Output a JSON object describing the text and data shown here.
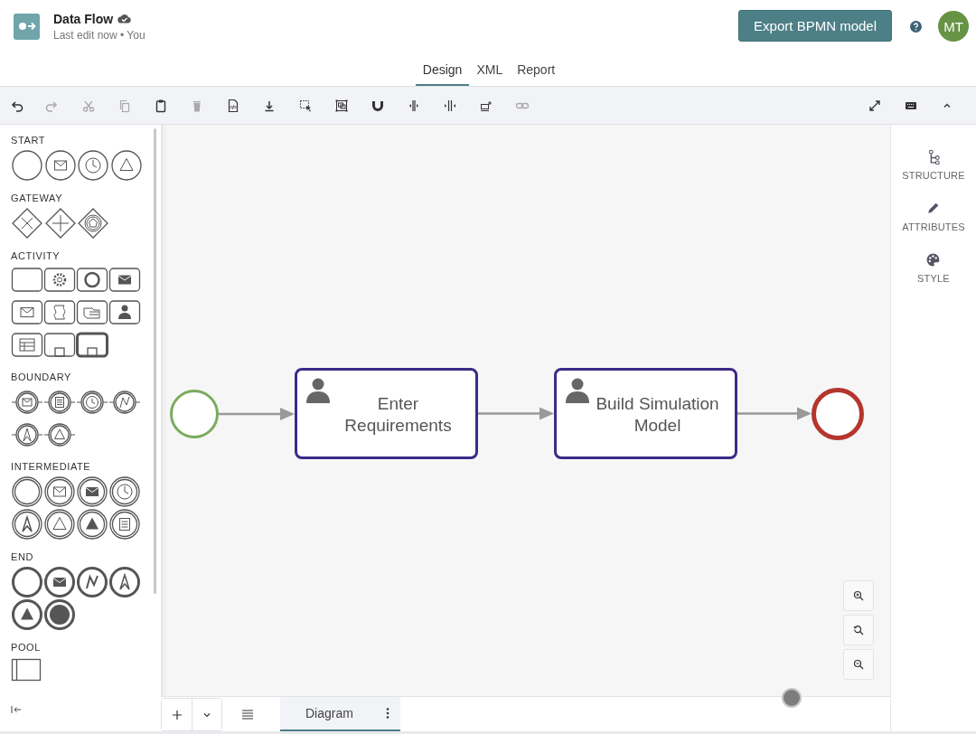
{
  "header": {
    "title": "Data Flow",
    "subtitle": "Last edit now • You",
    "export_button": "Export BPMN model",
    "avatar": "MT"
  },
  "tabs": [
    {
      "label": "Design",
      "selected": true
    },
    {
      "label": "XML",
      "selected": false
    },
    {
      "label": "Report",
      "selected": false
    }
  ],
  "toolbar": [
    {
      "disabled": false
    },
    {
      "disabled": true
    },
    {
      "disabled": true
    },
    {
      "disabled": true
    },
    {
      "disabled": false
    },
    {
      "disabled": true
    },
    {
      "disabled": false
    },
    {
      "disabled": false
    },
    {
      "disabled": false
    },
    {
      "disabled": false
    },
    {
      "disabled": false
    },
    {
      "disabled": false
    },
    {
      "disabled": false
    },
    {
      "disabled": false
    },
    {
      "disabled": true
    }
  ],
  "palette": [
    {
      "title": "START"
    },
    {
      "title": "GATEWAY"
    },
    {
      "title": "ACTIVITY"
    },
    {
      "title": "BOUNDARY"
    },
    {
      "title": "INTERMEDIATE"
    },
    {
      "title": "END"
    },
    {
      "title": "POOL"
    }
  ],
  "diagram": {
    "nodes": [
      {
        "kind": "start"
      },
      {
        "kind": "task",
        "label": "Enter Requirements"
      },
      {
        "kind": "task",
        "label": "Build Simulation Model"
      },
      {
        "kind": "end"
      }
    ]
  },
  "side_panel": [
    {
      "label": "STRUCTURE"
    },
    {
      "label": "ATTRIBUTES"
    },
    {
      "label": "STYLE"
    }
  ],
  "bottom_tabs": [
    {
      "label": "Diagram",
      "selected": true
    }
  ]
}
